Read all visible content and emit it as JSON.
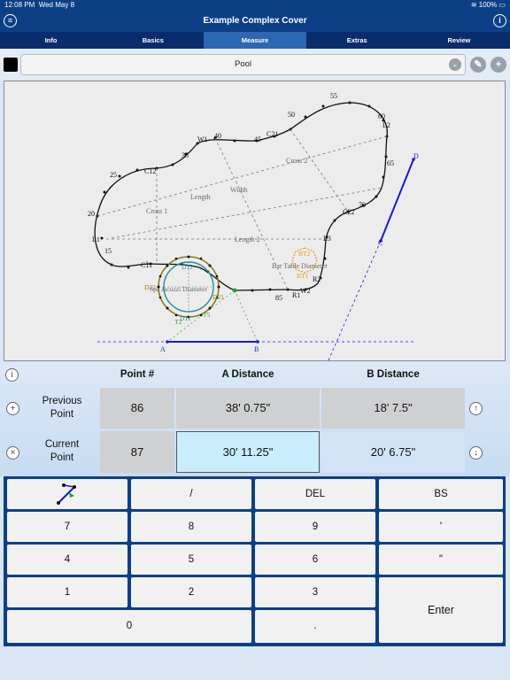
{
  "status": {
    "time": "12:08 PM",
    "date": "Wed May 8",
    "battery": "100%"
  },
  "app": {
    "title": "Example Complex Cover",
    "menu_icon": "list-icon",
    "info_icon": "info-icon"
  },
  "tabs": [
    {
      "label": "Info",
      "active": false
    },
    {
      "label": "Basics",
      "active": false
    },
    {
      "label": "Measure",
      "active": true
    },
    {
      "label": "Extras",
      "active": false
    },
    {
      "label": "Review",
      "active": false
    }
  ],
  "layer": {
    "name": "Pool",
    "swatch_color": "#000000"
  },
  "drawing": {
    "perimeter_labels": [
      "55",
      "50",
      "60",
      "L2",
      "45",
      "C21",
      "40",
      "W1",
      "35",
      "C12",
      "25",
      "65",
      "Cross 2",
      "Width",
      "Length",
      "Cross 1",
      "20",
      "C22",
      "70",
      "L1",
      "Length 2",
      "L3",
      "15",
      "C11",
      "Bar Table Diameter",
      "R2",
      "W2",
      "R1",
      "85",
      "A",
      "B",
      "C",
      "D"
    ],
    "circle_labels": [
      "D12",
      "D22",
      "Spa Jacuzzi Diameter",
      "D21",
      "D11",
      "T2",
      "T5",
      "BT2",
      "BT1"
    ],
    "accent_color": "#1a1acc",
    "spa_outer_color": "#8e7a1c",
    "spa_inner_color": "#1f8f9a",
    "spa_dots_color": "#2e9c3a",
    "bar_table_color": "#e59a1a"
  },
  "measure": {
    "headers": {
      "point": "Point #",
      "a": "A Distance",
      "b": "B Distance"
    },
    "previous": {
      "label_line1": "Previous",
      "label_line2": "Point",
      "point": "86",
      "a": "38' 0.75\"",
      "b": "18' 7.5\""
    },
    "current": {
      "label_line1": "Current",
      "label_line2": "Point",
      "point": "87",
      "a": "30' 11.25\"",
      "b": "20' 6.75\""
    }
  },
  "keypad": {
    "row1": [
      "/",
      "DEL",
      "BS"
    ],
    "row2": [
      "7",
      "8",
      "9",
      "'"
    ],
    "row3": [
      "4",
      "5",
      "6",
      "\""
    ],
    "row4": [
      "1",
      "2",
      "3"
    ],
    "row5": [
      "0",
      "."
    ],
    "enter": "Enter"
  }
}
